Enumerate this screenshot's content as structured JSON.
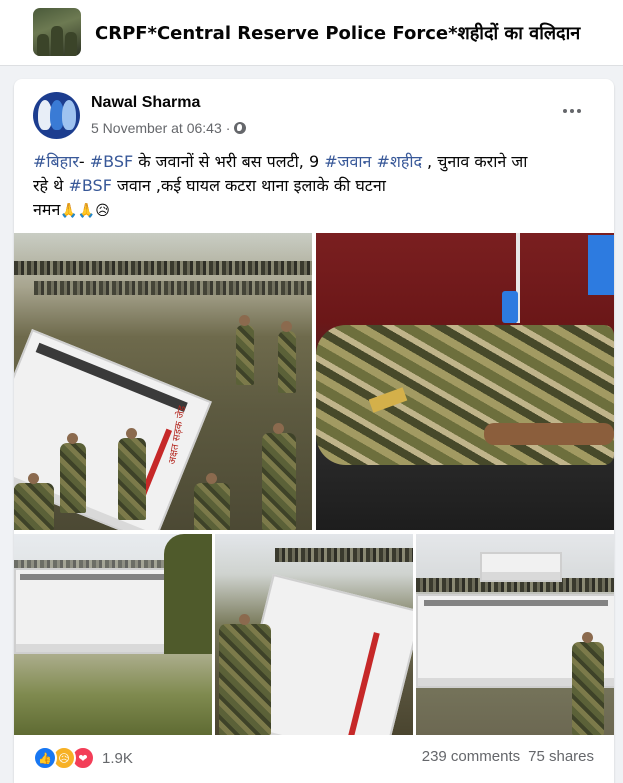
{
  "group": {
    "title": "CRPF*Central Reserve Police Force*शहीदों का वलिदान"
  },
  "post": {
    "author": "Nawal Sharma",
    "timestamp": "5 November at 06:43",
    "separator": "·",
    "privacy_icon": "globe-icon",
    "text": {
      "line1": {
        "tag1": "#बिहार",
        "sep1": "- ",
        "tag2": "#BSF",
        "mid1": " के जवानों से भरी बस पलटी, 9 ",
        "tag3": "#जवान",
        "space": " ",
        "tag4": "#शहीद",
        "tail1": " , चुनाव कराने जा"
      },
      "line2": {
        "head": "रहे थे ",
        "tag5": "#BSF",
        "tail2": " जवान ,कई घायल कटरा थाना इलाके की घटना"
      },
      "line3": {
        "word": "नमन",
        "emojis": "🙏🙏😥"
      }
    }
  },
  "photos": [
    {
      "name": "overturned-bus-crowd-photo"
    },
    {
      "name": "injured-jawan-hospital-photo"
    },
    {
      "name": "bus-side-field-photo"
    },
    {
      "name": "bus-roof-soldiers-photo"
    },
    {
      "name": "bus-field-soldier-phone-photo"
    }
  ],
  "photo_texts": {
    "bus_lettering": "अक्षत सड़क जेड"
  },
  "footer": {
    "reaction_icons": [
      "like-icon",
      "sad-icon",
      "love-icon"
    ],
    "reaction_count": "1.9K",
    "comments": "239 comments",
    "shares": "75 shares"
  },
  "colors": {
    "background": "#f0f2f5",
    "card": "#ffffff",
    "hashtag": "#385898",
    "meta_text": "#65676b",
    "like": "#1877f2",
    "love": "#f33e58"
  }
}
